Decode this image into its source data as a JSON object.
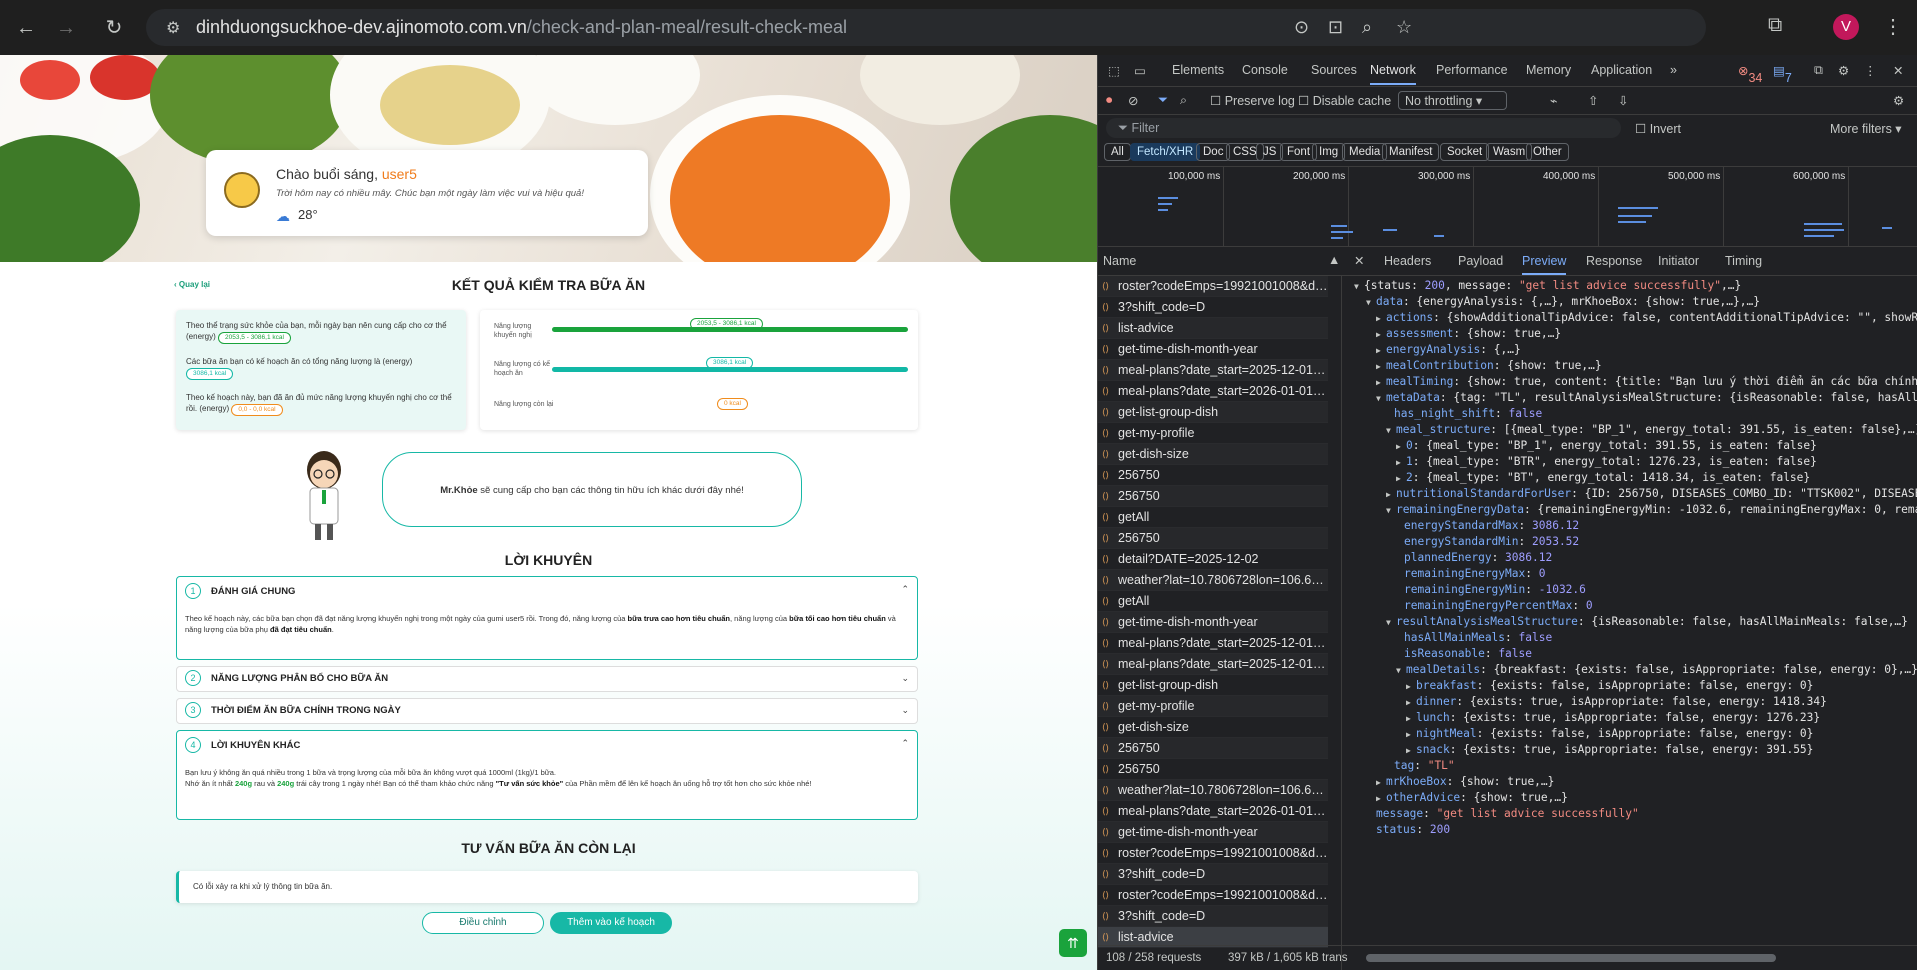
{
  "browser": {
    "url_host": "dinhduongsuckhoe-dev.ajinomoto.com.vn",
    "url_path": "/check-and-plan-meal/result-check-meal",
    "avatar": "V"
  },
  "hero": {
    "greeting": "Chào buổi sáng, ",
    "username": "user5",
    "subtitle": "Trời hôm nay có nhiều mây. Chúc bạn một ngày làm việc vui và hiệu quả!",
    "temperature": "28°"
  },
  "back_label": "Quay lại",
  "result": {
    "title": "KẾT QUẢ KIỂM TRA BỮA ĂN",
    "lines": [
      {
        "text": "Theo thể trạng sức khỏe của bạn, mỗi ngày bạn nên cung cấp cho cơ thể (energy)",
        "pill": "2053,5 - 3086,1 kcal"
      },
      {
        "text": "Các bữa ăn bạn có kế hoạch ăn có tổng năng lượng là (energy)",
        "pill": "3086,1 kcal"
      },
      {
        "text": "Theo kế hoạch này, bạn đã ăn đủ mức năng lượng khuyến nghị cho cơ thể rồi. (energy)",
        "pill": "0,0 - 0,0 kcal"
      }
    ],
    "bars": [
      {
        "label": "Năng lượng khuyến nghị",
        "pill": "2053,5 - 3086,1 kcal",
        "color": "#1aa33c",
        "fill": 1.0
      },
      {
        "label": "Năng lượng có kế hoạch ăn",
        "pill": "3086,1 kcal",
        "color": "#12b8a6",
        "fill": 1.0
      },
      {
        "label": "Năng lượng còn lại",
        "pill": "0 kcal",
        "color": "#f08c1c",
        "fill": 0.0
      }
    ]
  },
  "mrkhoe": {
    "name": "Mr.Khỏe",
    "text": " sẽ cung cấp cho bạn các thông tin hữu ích khác dưới đây nhé!"
  },
  "advice": {
    "title": "LỜI KHUYÊN",
    "items": [
      {
        "num": "1",
        "title": "ĐÁNH GIÁ CHUNG",
        "open": true
      },
      {
        "num": "2",
        "title": "NĂNG LƯỢNG PHÂN BỔ CHO BỮA ĂN",
        "open": false
      },
      {
        "num": "3",
        "title": "THỜI ĐIỂM ĂN BỮA CHÍNH TRONG NGÀY",
        "open": false
      },
      {
        "num": "4",
        "title": "LỜI KHUYÊN KHÁC",
        "open": true
      }
    ],
    "assess_1": "Theo kế hoạch này, các bữa bạn chọn đã đạt năng lượng khuyến nghị trong một ngày của gumi user5 rồi. Trong đó, năng lượng của ",
    "assess_b1": "bữa trưa cao hơn tiêu chuẩn",
    "assess_2": ", năng lượng của ",
    "assess_b2": "bữa tối cao hơn tiêu chuẩn",
    "assess_3": " và năng lượng của bữa phụ ",
    "assess_b3": "đã đạt tiêu chuẩn",
    "assess_4": ".",
    "other_1": "Bạn lưu ý không ăn quá nhiều trong 1 bữa và trọng lượng của mỗi bữa ăn không vượt quá 1000ml (1kg)/1 bữa.",
    "other_2a": "Nhớ ăn ít nhất ",
    "other_g1": "240g",
    "other_2b": " rau và ",
    "other_g2": "240g",
    "other_2c": " trái cây trong 1 ngày nhé! Bạn có thể tham khảo chức năng ",
    "other_b": "\"Tư vấn sức khỏe\"",
    "other_2d": " của Phần mềm để lên kế hoạch ăn uống hỗ trợ tốt hơn cho sức khỏe nhé!"
  },
  "remaining": {
    "title": "TƯ VẤN BỮA ĂN CÒN LẠI",
    "error": "Có lỗi xảy ra khi xử lý thông tin bữa ăn."
  },
  "buttons": {
    "adjust": "Điều chỉnh",
    "add_plan": "Thêm vào kế hoạch"
  },
  "devtools": {
    "tabs": [
      "Elements",
      "Console",
      "Sources",
      "Network",
      "Performance",
      "Memory",
      "Application"
    ],
    "selected_tab": "Network",
    "errors": "34",
    "issues": "7",
    "preserve_log": "Preserve log",
    "disable_cache": "Disable cache",
    "throttling": "No throttling",
    "filter_placeholder": "Filter",
    "invert": "Invert",
    "more_filters": "More filters",
    "types": [
      "All",
      "Fetch/XHR",
      "Doc",
      "CSS",
      "JS",
      "Font",
      "Img",
      "Media",
      "Manifest",
      "Socket",
      "Wasm",
      "Other"
    ],
    "selected_type": "Fetch/XHR",
    "timeline_labels": [
      "100,000 ms",
      "200,000 ms",
      "300,000 ms",
      "400,000 ms",
      "500,000 ms",
      "600,000 ms"
    ],
    "name_header": "Name",
    "detail_tabs": [
      "Headers",
      "Payload",
      "Preview",
      "Response",
      "Initiator",
      "Timing"
    ],
    "selected_detail": "Preview",
    "requests": [
      "roster?codeEmps=19921001008&dat...",
      "3?shift_code=D",
      "list-advice",
      "get-time-dish-month-year",
      "meal-plans?date_start=2025-12-01&...",
      "meal-plans?date_start=2026-01-01&...",
      "get-list-group-dish",
      "get-my-profile",
      "get-dish-size",
      "256750",
      "256750",
      "getAll",
      "256750",
      "detail?DATE=2025-12-02",
      "weather?lat=10.7806728lon=106.64...",
      "getAll",
      "get-time-dish-month-year",
      "meal-plans?date_start=2025-12-01&...",
      "meal-plans?date_start=2025-12-01&...",
      "get-list-group-dish",
      "get-my-profile",
      "get-dish-size",
      "256750",
      "256750",
      "weather?lat=10.7806728lon=106.64...",
      "meal-plans?date_start=2026-01-01&...",
      "get-time-dish-month-year",
      "roster?codeEmps=19921001008&dat...",
      "3?shift_code=D",
      "roster?codeEmps=19921001008&dat...",
      "3?shift_code=D",
      "list-advice"
    ],
    "status_bar": "108 / 258 requests",
    "transfer": "397 kB / 1,605 kB trans"
  }
}
